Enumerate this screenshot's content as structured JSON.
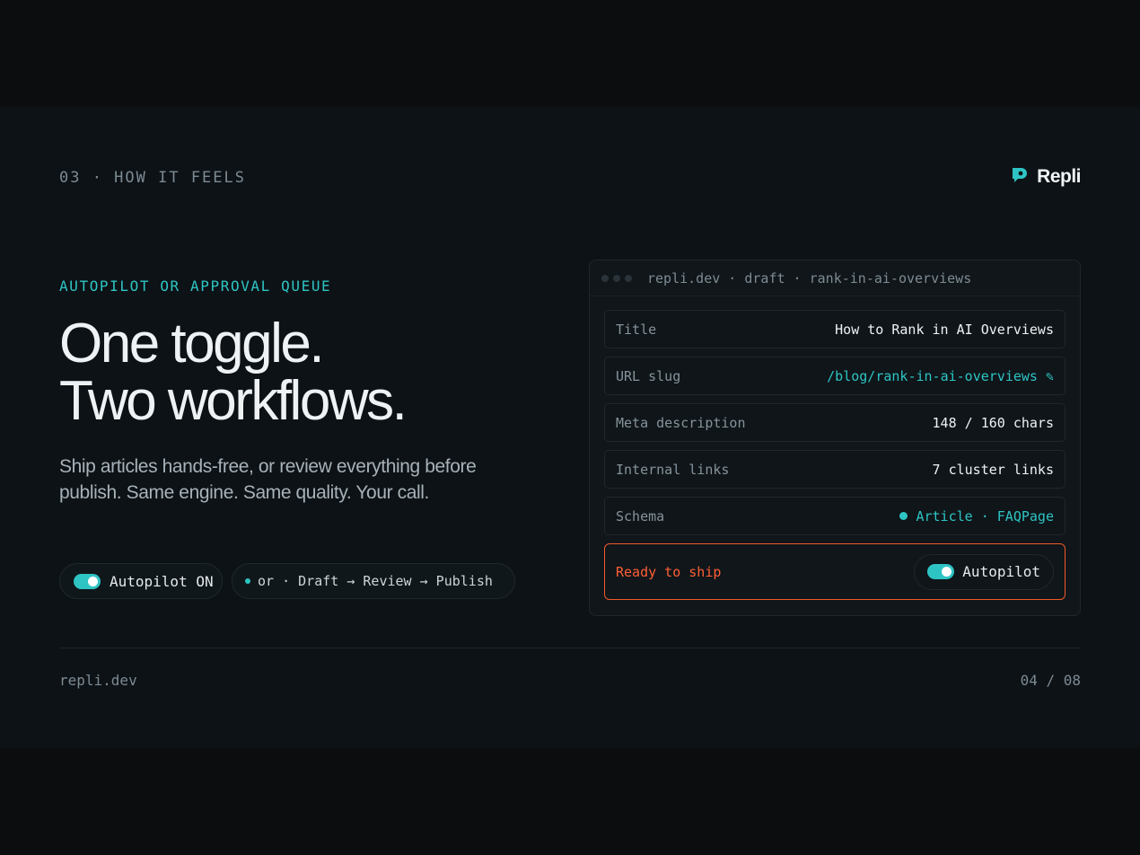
{
  "section_label": "03 · HOW IT FEELS",
  "brand": {
    "name": "Repli",
    "icon": "repli-logo-icon",
    "accent": "#2ec4c4"
  },
  "hero": {
    "eyebrow": "AUTOPILOT OR APPROVAL QUEUE",
    "headline_line1": "One toggle.",
    "headline_line2": "Two workflows.",
    "subtext": "Ship articles hands-free, or review everything before publish. Same engine. Same quality. Your call."
  },
  "pills": {
    "autopilot_label": "Autopilot ON",
    "workflow_label": "or · Draft → Review → Publish"
  },
  "panel": {
    "path": "repli.dev · draft · rank-in-ai-overviews",
    "rows": [
      {
        "label": "Title",
        "value": "How to Rank in AI Overviews"
      },
      {
        "label": "URL slug",
        "value": "/blog/rank-in-ai-overviews",
        "icon": "pencil-icon",
        "edit_glyph": "✎"
      },
      {
        "label": "Meta description",
        "value": "148 / 160 chars"
      },
      {
        "label": "Internal links",
        "value": "7 cluster links"
      },
      {
        "label": "Schema",
        "value": "Article · FAQPage"
      }
    ],
    "ready_label": "Ready to ship",
    "toggle_label": "Autopilot",
    "alert_color": "#f05a2a"
  },
  "footer": {
    "site": "repli.dev",
    "page": "04 / 08"
  }
}
